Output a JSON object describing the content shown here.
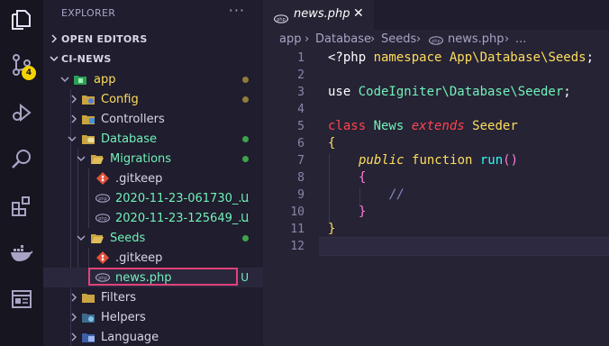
{
  "activity_bar": {
    "badge_count": "4",
    "items": [
      "explorer-icon",
      "source-control-icon",
      "run-debug-icon",
      "search-icon",
      "extensions-icon",
      "docker-icon",
      "remote-explorer-icon"
    ]
  },
  "sidebar": {
    "title": "EXPLORER",
    "more": "···",
    "open_editors": "OPEN EDITORS",
    "workspace": "CI-NEWS",
    "tree": [
      {
        "label": "app",
        "color": "#fede5d",
        "status": "dot",
        "dot_color": "#8f7b3a"
      },
      {
        "label": "Config",
        "color": "#fede5d",
        "status": "dot",
        "dot_color": "#8f7b3a"
      },
      {
        "label": "Controllers",
        "color": "#d8d6e8",
        "status": ""
      },
      {
        "label": "Database",
        "color": "#72f1b8",
        "status": "dot",
        "dot_color": "#3fa34d"
      },
      {
        "label": "Migrations",
        "color": "#72f1b8",
        "status": "dot",
        "dot_color": "#3fa34d"
      },
      {
        "label": ".gitkeep",
        "color": "#d8d6e8",
        "status": ""
      },
      {
        "label": "2020-11-23-061730_...",
        "color": "#72f1b8",
        "status": "U"
      },
      {
        "label": "2020-11-23-125649_...",
        "color": "#72f1b8",
        "status": "U"
      },
      {
        "label": "Seeds",
        "color": "#72f1b8",
        "status": "dot",
        "dot_color": "#3fa34d"
      },
      {
        "label": ".gitkeep",
        "color": "#d8d6e8",
        "status": ""
      },
      {
        "label": "news.php",
        "color": "#72f1b8",
        "status": "U"
      },
      {
        "label": "Filters",
        "color": "#d8d6e8",
        "status": ""
      },
      {
        "label": "Helpers",
        "color": "#d8d6e8",
        "status": ""
      },
      {
        "label": "Language",
        "color": "#d8d6e8",
        "status": ""
      }
    ]
  },
  "editor": {
    "tab_label": "news.php",
    "tab_close": "✕",
    "breadcrumbs": [
      "app",
      "Database",
      "Seeds",
      "news.php",
      "..."
    ],
    "line_numbers": [
      "1",
      "2",
      "3",
      "4",
      "5",
      "6",
      "7",
      "8",
      "9",
      "10",
      "11",
      "12"
    ],
    "code": {
      "l1_php": "<?php ",
      "l1_namespace": "namespace",
      "l1_ns": " App\\Database\\Seeds",
      "l1_semi": ";",
      "l3_use": "use ",
      "l3_ns": "CodeIgniter\\Database\\Seeder",
      "l3_semi": ";",
      "l5_class": "class ",
      "l5_name": "News ",
      "l5_extends": "extends ",
      "l5_parent": "Seeder",
      "l6_brace": "{",
      "l7_public": "public ",
      "l7_function": "function ",
      "l7_name": "run",
      "l7_parens": "()",
      "l8_brace": "{",
      "l9_comment": "//",
      "l10_brace": "}",
      "l11_brace": "}"
    }
  }
}
